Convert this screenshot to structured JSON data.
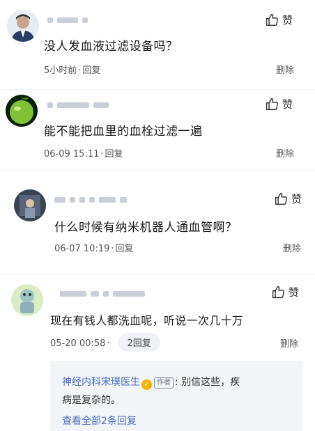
{
  "comments": [
    {
      "text": "没人发血液过滤设备吗？",
      "time": "5小时前",
      "reply": "回复",
      "like": "赞",
      "delete": "删除"
    },
    {
      "text": "能不能把血里的血栓过滤一遍",
      "time": "06-09 15:11",
      "reply": "回复",
      "like": "赞",
      "delete": "删除"
    },
    {
      "text": "什么时候有纳米机器人通血管啊？",
      "time": "06-07 10:19",
      "reply": "回复",
      "like": "赞",
      "delete": "删除"
    },
    {
      "text": "现在有钱人都洗血呢，听说一次几十万",
      "time": "05-20 00:58",
      "reply_count": "2回复",
      "like": "赞",
      "delete": "删除"
    }
  ],
  "reply_preview": {
    "author": "神经内科宋璞医生",
    "verified_icon": "v-badge-icon",
    "tag": "作者",
    "text_line1": ": 别信这些，疾",
    "text_line2": "病是复杂的。",
    "view_all": "查看全部2条回复"
  },
  "colors": {
    "link": "#4a6fbf",
    "meta": "#555555",
    "reply_bg": "#f3f4f7"
  }
}
